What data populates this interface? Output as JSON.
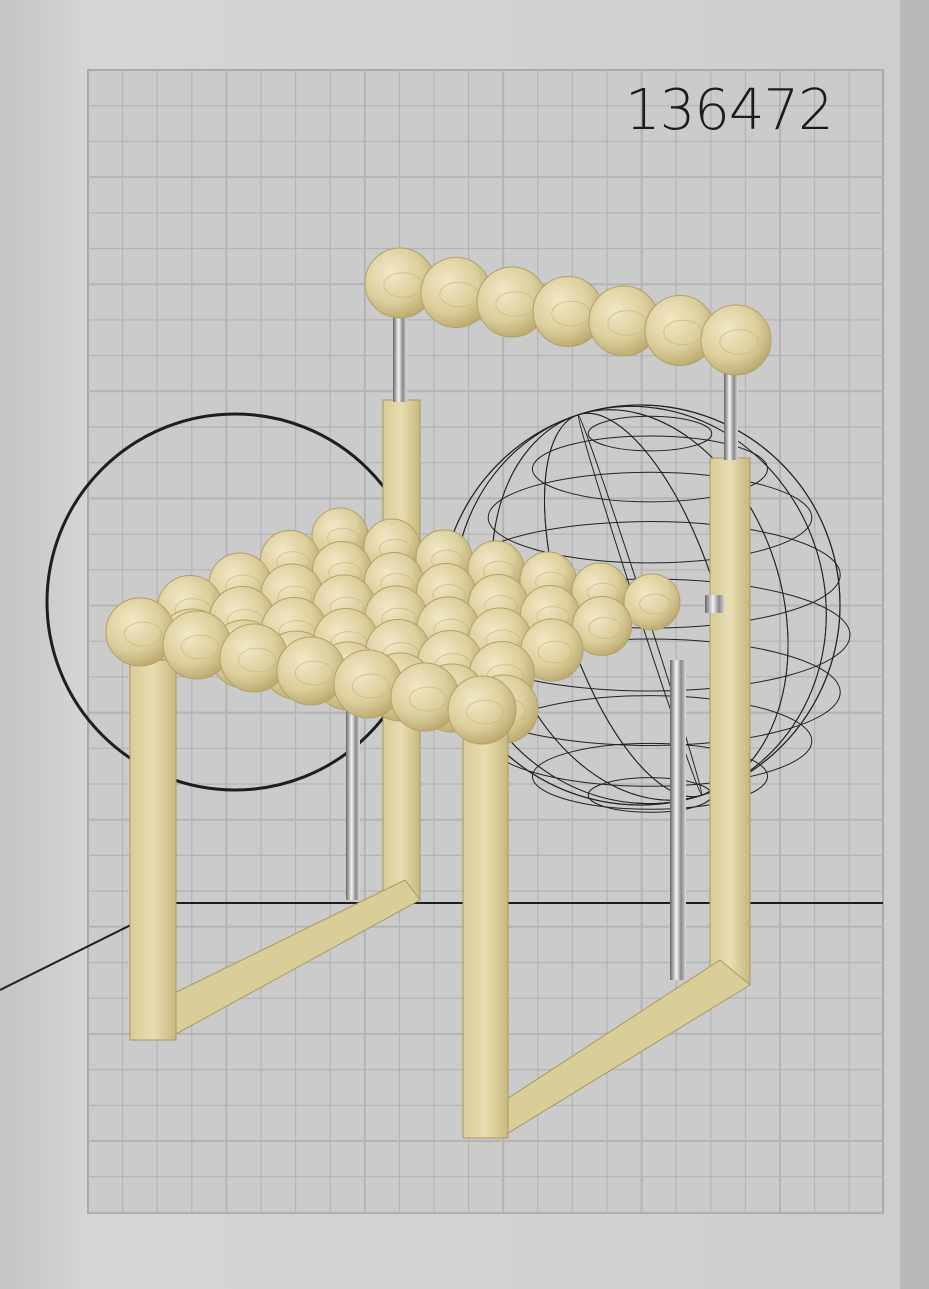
{
  "poster": {
    "code": "136472"
  },
  "colors": {
    "paper": "#cfcfcf",
    "grid": "#b3b3b3",
    "wood": "#e2d6a8",
    "wood_dark": "#c9b97f",
    "chrome": "#9a9a9a",
    "line": "#1e1e1e"
  }
}
